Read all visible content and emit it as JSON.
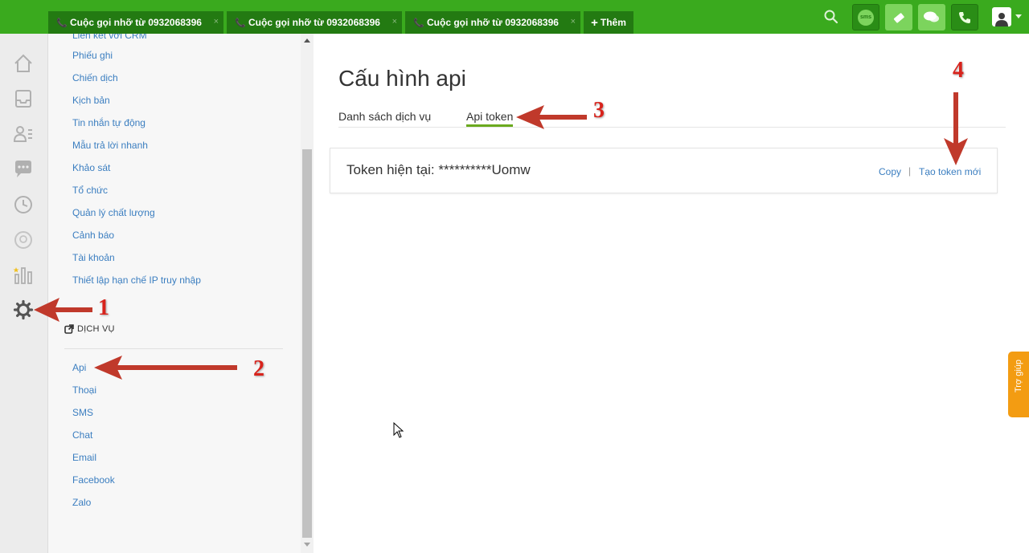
{
  "topbar": {
    "tabs": [
      {
        "label": "Cuộc gọi nhỡ từ 0932068396"
      },
      {
        "label": "Cuộc gọi nhỡ từ 0932068396"
      },
      {
        "label": "Cuộc gọi nhỡ từ 0932068396"
      }
    ],
    "add_tab_label": "Thêm",
    "sms_badge": "sms"
  },
  "menu": {
    "items_top": [
      "Phiếu ghi",
      "Chiến dịch",
      "Kịch bản",
      "Tin nhắn tự động",
      "Mẫu trả lời nhanh",
      "Khảo sát",
      "Tổ chức",
      "Quản lý chất lượng",
      "Cảnh báo",
      "Tài khoản",
      "Thiết lập hạn chế IP truy nhập"
    ],
    "section_title": "DỊCH VỤ",
    "items_service": [
      "Api",
      "Thoại",
      "SMS",
      "Chat",
      "Email",
      "Facebook",
      "Zalo"
    ]
  },
  "main": {
    "title": "Cấu hình api",
    "tabs": [
      "Danh sách dịch vụ",
      "Api token"
    ],
    "active_tab": "Api token",
    "token_label": "Token hiện tại: **********Uomw",
    "copy_label": "Copy",
    "separator": "|",
    "new_token_label": "Tạo token mới"
  },
  "help_label": "Trợ giúp",
  "annotations": [
    "1",
    "2",
    "3",
    "4"
  ],
  "colors": {
    "topbar": "#3aaa1e",
    "tab_bg": "#237a12",
    "link": "#3b7ec0",
    "active_tab_underline": "#6aaa1e",
    "annotation": "#d8231c",
    "help": "#f39c12"
  }
}
